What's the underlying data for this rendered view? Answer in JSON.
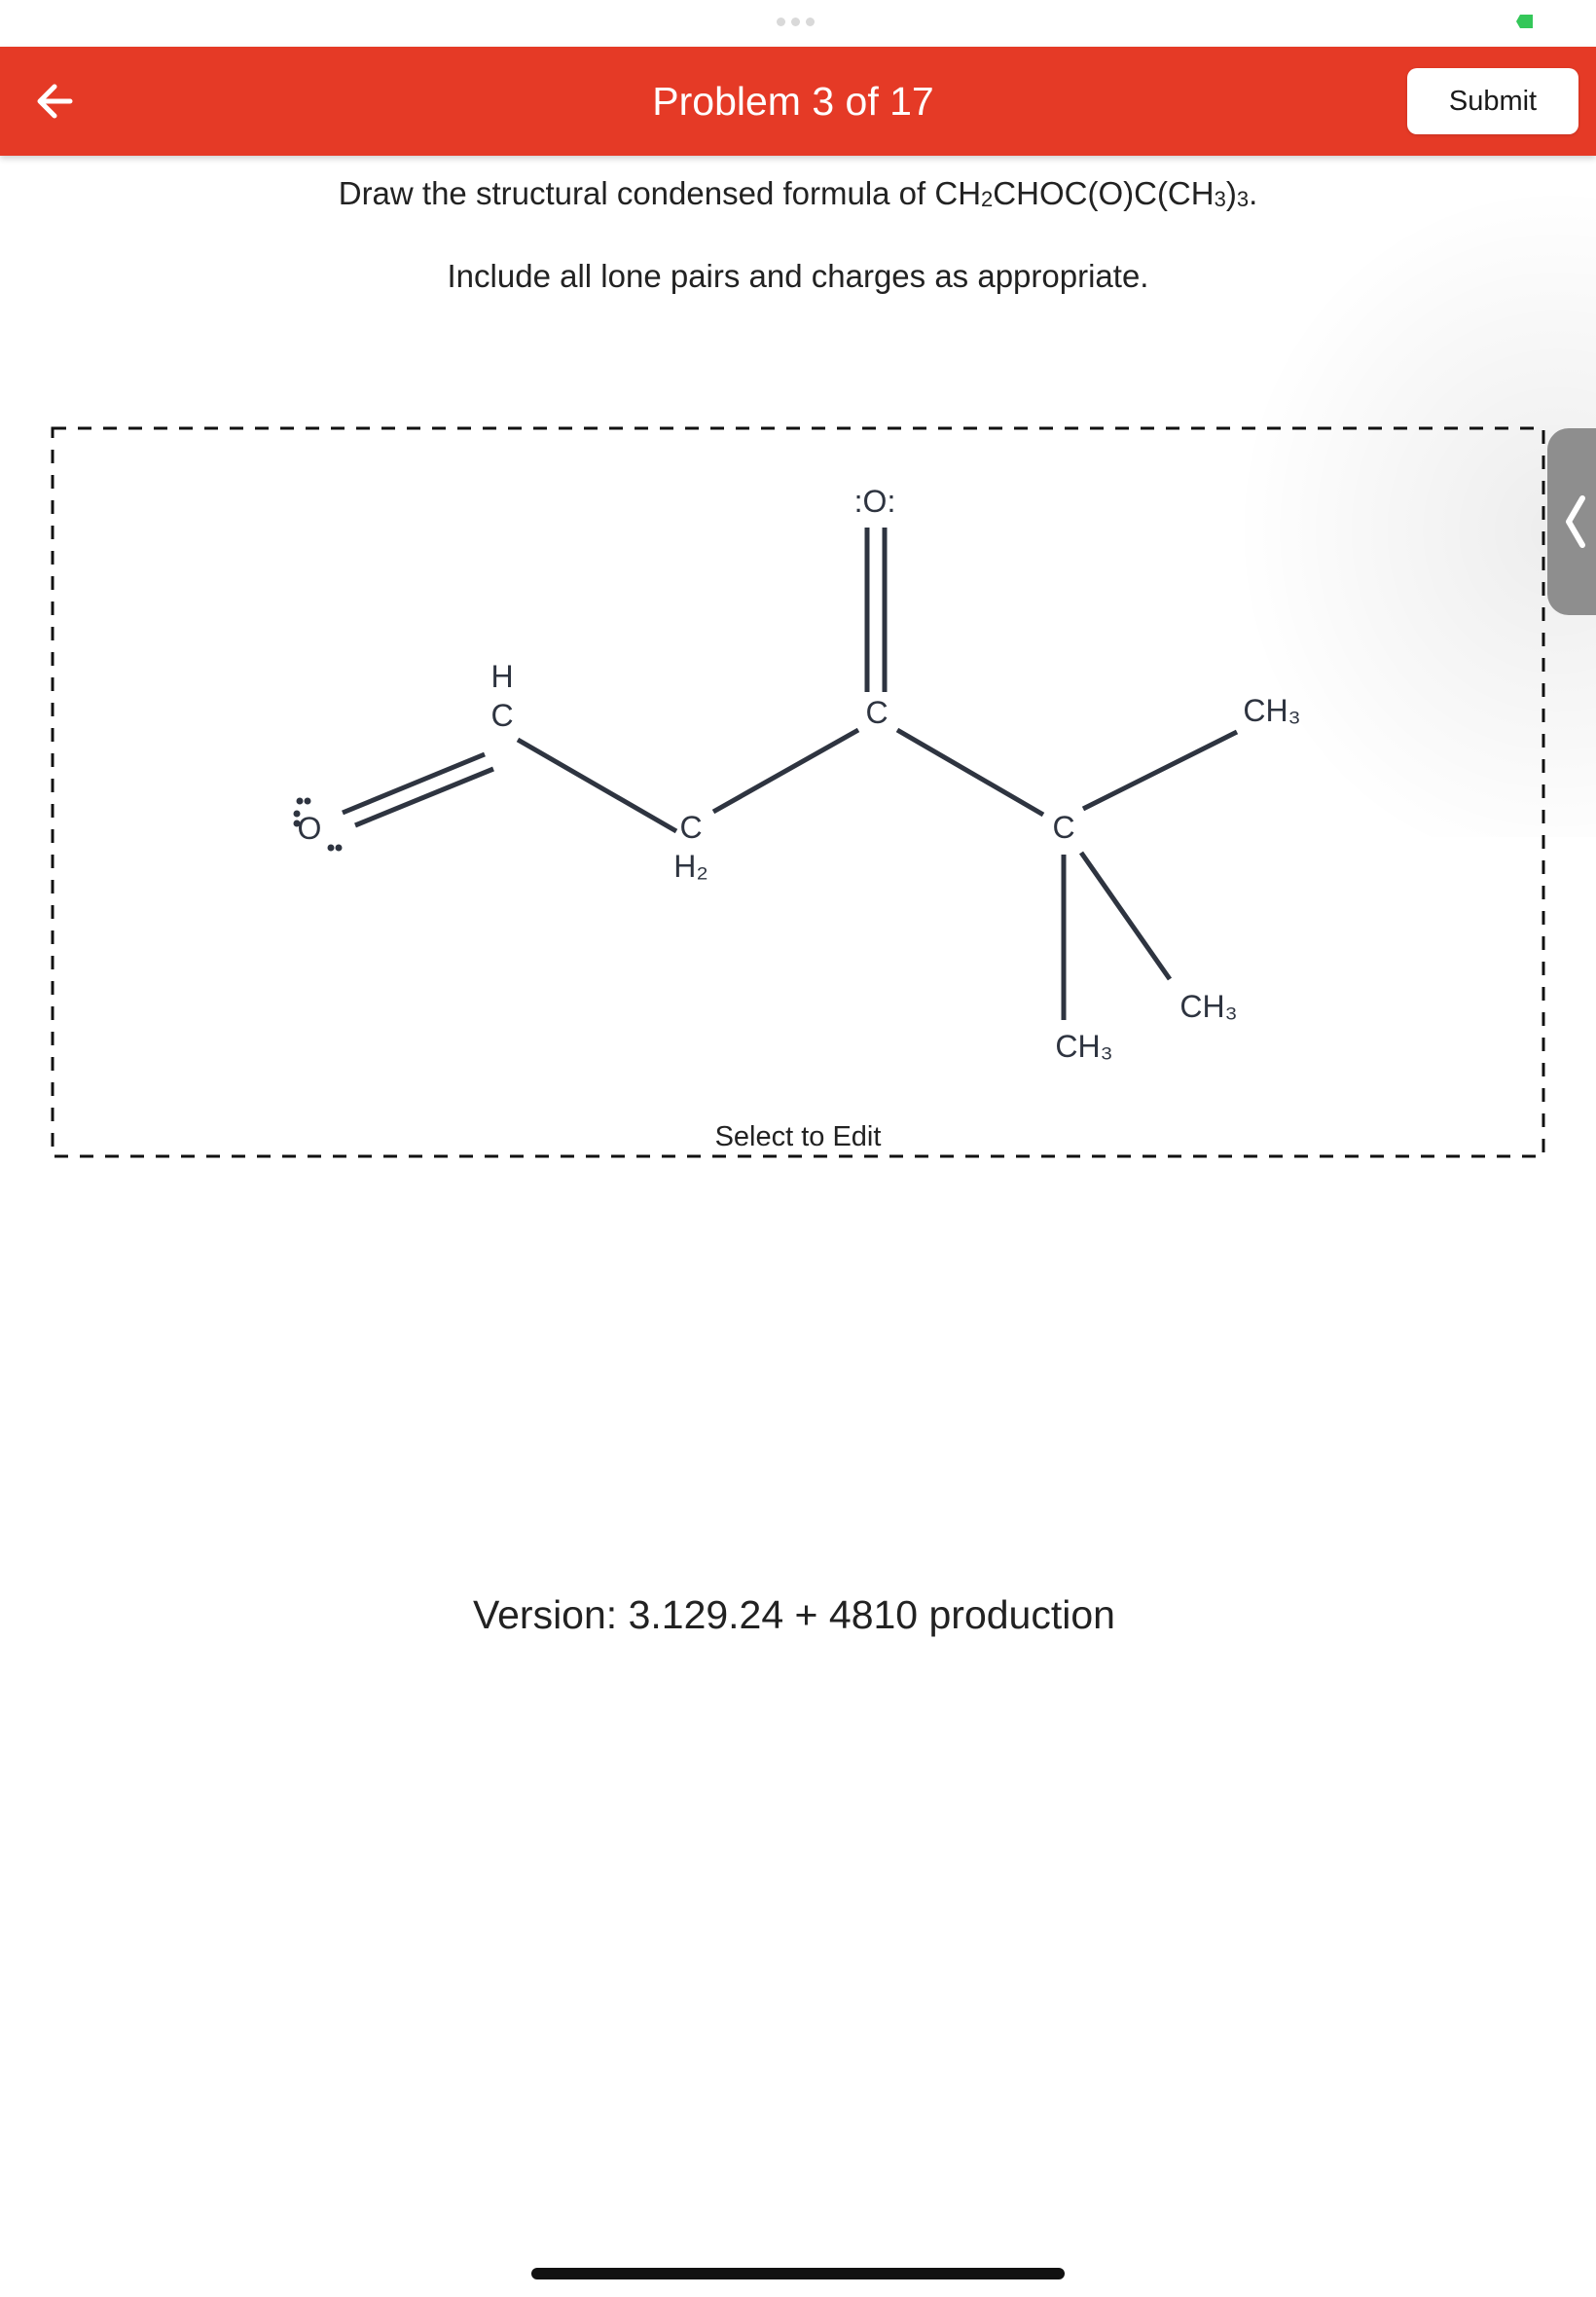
{
  "header": {
    "title": "Problem 3 of 17",
    "submit_label": "Submit",
    "color": "#e53a26"
  },
  "question": {
    "line1": {
      "prefix": "Draw the structural condensed formula of ",
      "formula_parts": [
        "CH",
        "2",
        "CHOC(O)C(CH",
        "3",
        ")",
        "3",
        "."
      ]
    },
    "line2": "Include all lone pairs and charges as appropriate."
  },
  "sketcher": {
    "hint": "Select to Edit",
    "atoms": {
      "o_left": "O",
      "c1_h": "H",
      "c1": "C",
      "c2": "C",
      "c2_h2": "H₂",
      "o_carbonyl": ":O:",
      "c3": "C",
      "c4": "C",
      "ch3_right": "CH₃",
      "ch3_lower_right": "CH₃",
      "ch3_down": "CH₃"
    }
  },
  "footer": {
    "version": "Version: 3.129.24 + 4810 production"
  },
  "icons": {
    "back": "arrow-left-icon",
    "drawer": "chevron-left-icon",
    "battery": "battery-icon"
  }
}
